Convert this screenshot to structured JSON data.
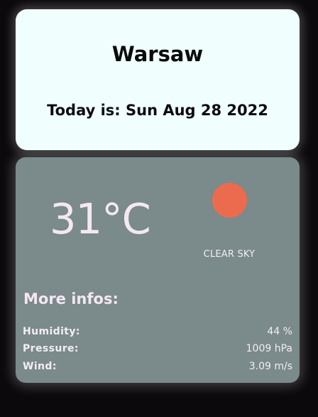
{
  "location": {
    "city": "Warsaw",
    "date_text": "Today is: Sun Aug 28 2022"
  },
  "weather": {
    "temperature": "31°C",
    "condition": "CLEAR SKY",
    "icon": "sun-icon",
    "icon_color": "#ec6b4f"
  },
  "details": {
    "heading": "More infos:",
    "rows": [
      {
        "label": "Humidity:",
        "value": "44 %"
      },
      {
        "label": "Pressure:",
        "value": "1009 hPa"
      },
      {
        "label": "Wind:",
        "value": "3.09 m/s"
      }
    ]
  },
  "colors": {
    "page_background": "#0b090b",
    "top_card": "#f0fffe",
    "weather_card": "#7b8a8a",
    "text_light": "#f3e8f4"
  }
}
